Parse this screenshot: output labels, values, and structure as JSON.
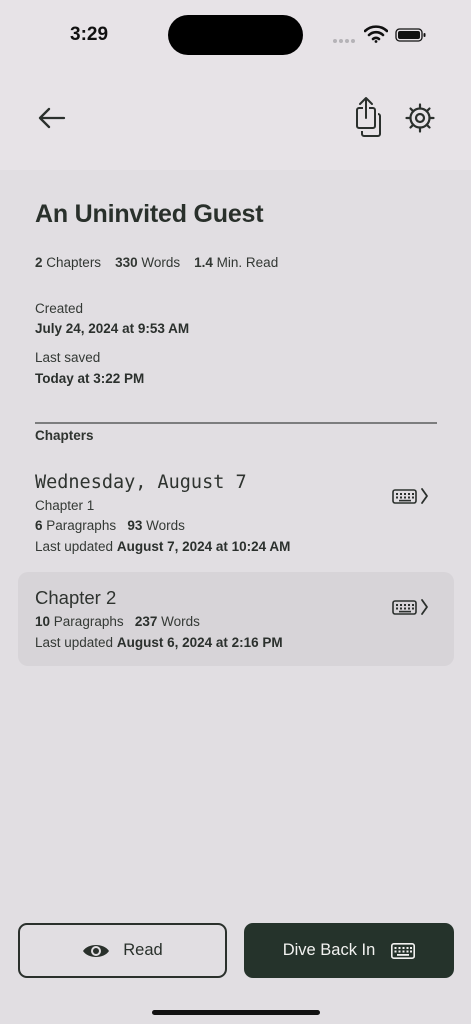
{
  "status_bar": {
    "time": "3:29"
  },
  "story": {
    "title": "An Uninvited Guest",
    "stats": [
      {
        "value": "2",
        "label": "Chapters"
      },
      {
        "value": "330",
        "label": "Words"
      },
      {
        "value": "1.4",
        "label": "Min. Read"
      }
    ],
    "created_label": "Created",
    "created_value": "July 24, 2024 at 9:53 AM",
    "saved_label": "Last saved",
    "saved_value": "Today at 3:22 PM"
  },
  "chapters_section": {
    "heading": "Chapters",
    "items": [
      {
        "title": "Wednesday, August 7",
        "subtitle": "Chapter 1",
        "paragraphs": "6",
        "paragraphs_label": "Paragraphs",
        "words": "93",
        "words_label": "Words",
        "updated_label": "Last updated",
        "updated_value": "August 7, 2024 at 10:24 AM"
      },
      {
        "title": "Chapter 2",
        "paragraphs": "10",
        "paragraphs_label": "Paragraphs",
        "words": "237",
        "words_label": "Words",
        "updated_label": "Last updated",
        "updated_value": "August 6, 2024 at 2:16 PM"
      }
    ]
  },
  "actions": {
    "read_label": "Read",
    "dive_label": "Dive Back In"
  },
  "icons": {
    "back": "arrow-left-icon",
    "share": "share-icon",
    "settings": "gear-icon",
    "keyboard": "keyboard-icon",
    "chevron": "chevron-right-icon",
    "eye": "eye-icon"
  },
  "colors": {
    "background": "#e1dee2",
    "header_background": "#e7e3e7",
    "text_primary": "#29302b",
    "primary_button": "#25332b",
    "selected_row": "#d7d4d8"
  }
}
